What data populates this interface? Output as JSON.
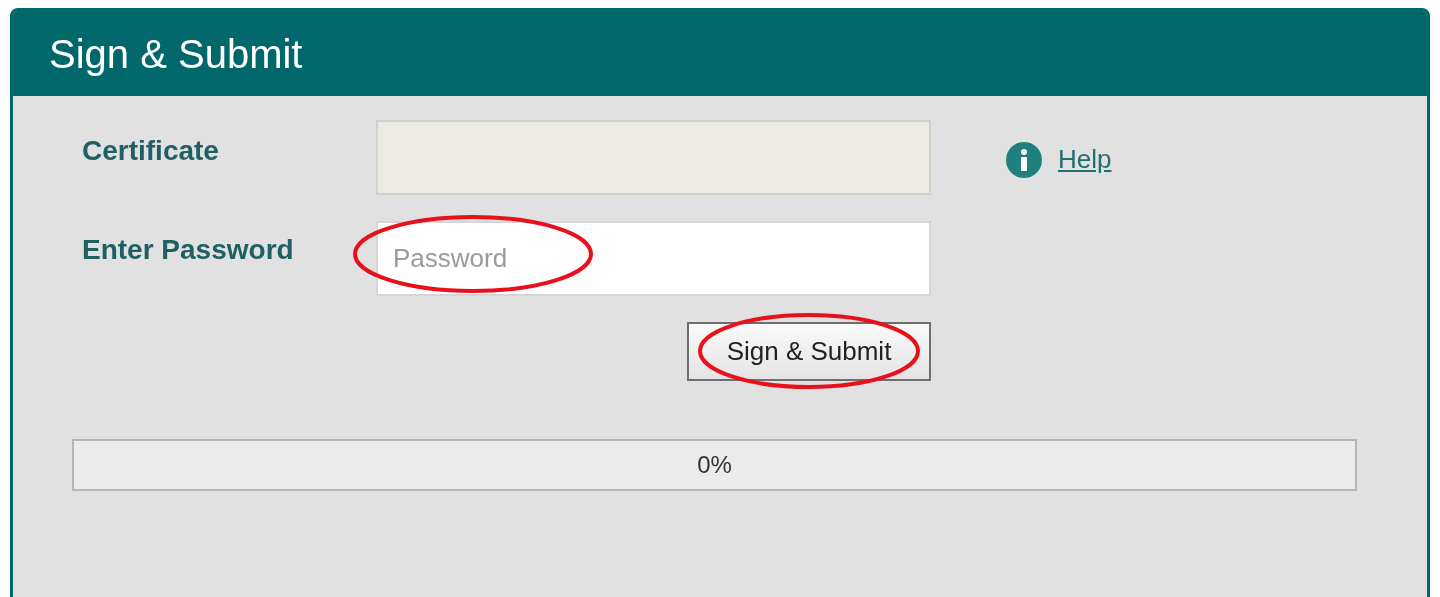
{
  "panel": {
    "title": "Sign & Submit"
  },
  "form": {
    "certificate": {
      "label": "Certificate",
      "disabled": true
    },
    "help": {
      "label": "Help"
    },
    "password": {
      "label": "Enter Password",
      "placeholder": "Password"
    },
    "submit": {
      "label": "Sign & Submit"
    }
  },
  "progress": {
    "level": 0,
    "reading": "0%"
  }
}
